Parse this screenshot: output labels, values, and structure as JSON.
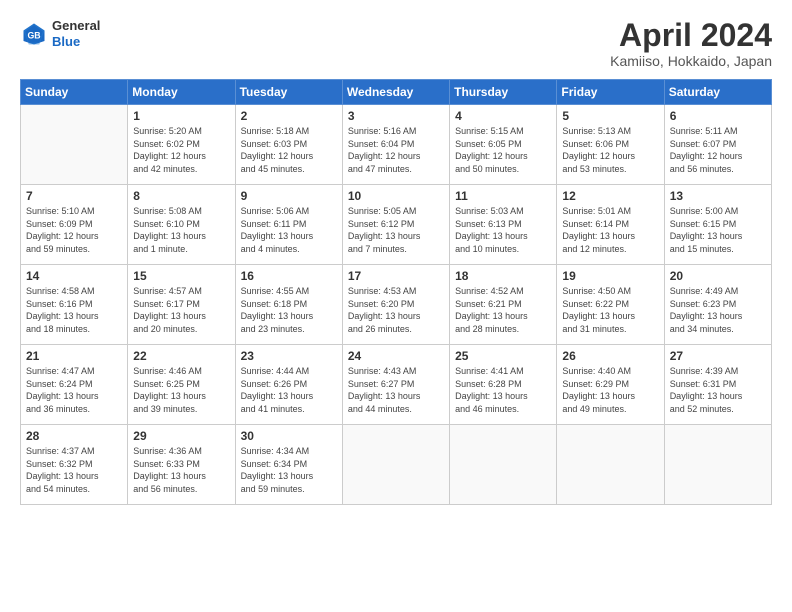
{
  "header": {
    "logo_general": "General",
    "logo_blue": "Blue",
    "month_title": "April 2024",
    "location": "Kamiiso, Hokkaido, Japan"
  },
  "days_of_week": [
    "Sunday",
    "Monday",
    "Tuesday",
    "Wednesday",
    "Thursday",
    "Friday",
    "Saturday"
  ],
  "weeks": [
    [
      {
        "day": "",
        "info": ""
      },
      {
        "day": "1",
        "info": "Sunrise: 5:20 AM\nSunset: 6:02 PM\nDaylight: 12 hours\nand 42 minutes."
      },
      {
        "day": "2",
        "info": "Sunrise: 5:18 AM\nSunset: 6:03 PM\nDaylight: 12 hours\nand 45 minutes."
      },
      {
        "day": "3",
        "info": "Sunrise: 5:16 AM\nSunset: 6:04 PM\nDaylight: 12 hours\nand 47 minutes."
      },
      {
        "day": "4",
        "info": "Sunrise: 5:15 AM\nSunset: 6:05 PM\nDaylight: 12 hours\nand 50 minutes."
      },
      {
        "day": "5",
        "info": "Sunrise: 5:13 AM\nSunset: 6:06 PM\nDaylight: 12 hours\nand 53 minutes."
      },
      {
        "day": "6",
        "info": "Sunrise: 5:11 AM\nSunset: 6:07 PM\nDaylight: 12 hours\nand 56 minutes."
      }
    ],
    [
      {
        "day": "7",
        "info": "Sunrise: 5:10 AM\nSunset: 6:09 PM\nDaylight: 12 hours\nand 59 minutes."
      },
      {
        "day": "8",
        "info": "Sunrise: 5:08 AM\nSunset: 6:10 PM\nDaylight: 13 hours\nand 1 minute."
      },
      {
        "day": "9",
        "info": "Sunrise: 5:06 AM\nSunset: 6:11 PM\nDaylight: 13 hours\nand 4 minutes."
      },
      {
        "day": "10",
        "info": "Sunrise: 5:05 AM\nSunset: 6:12 PM\nDaylight: 13 hours\nand 7 minutes."
      },
      {
        "day": "11",
        "info": "Sunrise: 5:03 AM\nSunset: 6:13 PM\nDaylight: 13 hours\nand 10 minutes."
      },
      {
        "day": "12",
        "info": "Sunrise: 5:01 AM\nSunset: 6:14 PM\nDaylight: 13 hours\nand 12 minutes."
      },
      {
        "day": "13",
        "info": "Sunrise: 5:00 AM\nSunset: 6:15 PM\nDaylight: 13 hours\nand 15 minutes."
      }
    ],
    [
      {
        "day": "14",
        "info": "Sunrise: 4:58 AM\nSunset: 6:16 PM\nDaylight: 13 hours\nand 18 minutes."
      },
      {
        "day": "15",
        "info": "Sunrise: 4:57 AM\nSunset: 6:17 PM\nDaylight: 13 hours\nand 20 minutes."
      },
      {
        "day": "16",
        "info": "Sunrise: 4:55 AM\nSunset: 6:18 PM\nDaylight: 13 hours\nand 23 minutes."
      },
      {
        "day": "17",
        "info": "Sunrise: 4:53 AM\nSunset: 6:20 PM\nDaylight: 13 hours\nand 26 minutes."
      },
      {
        "day": "18",
        "info": "Sunrise: 4:52 AM\nSunset: 6:21 PM\nDaylight: 13 hours\nand 28 minutes."
      },
      {
        "day": "19",
        "info": "Sunrise: 4:50 AM\nSunset: 6:22 PM\nDaylight: 13 hours\nand 31 minutes."
      },
      {
        "day": "20",
        "info": "Sunrise: 4:49 AM\nSunset: 6:23 PM\nDaylight: 13 hours\nand 34 minutes."
      }
    ],
    [
      {
        "day": "21",
        "info": "Sunrise: 4:47 AM\nSunset: 6:24 PM\nDaylight: 13 hours\nand 36 minutes."
      },
      {
        "day": "22",
        "info": "Sunrise: 4:46 AM\nSunset: 6:25 PM\nDaylight: 13 hours\nand 39 minutes."
      },
      {
        "day": "23",
        "info": "Sunrise: 4:44 AM\nSunset: 6:26 PM\nDaylight: 13 hours\nand 41 minutes."
      },
      {
        "day": "24",
        "info": "Sunrise: 4:43 AM\nSunset: 6:27 PM\nDaylight: 13 hours\nand 44 minutes."
      },
      {
        "day": "25",
        "info": "Sunrise: 4:41 AM\nSunset: 6:28 PM\nDaylight: 13 hours\nand 46 minutes."
      },
      {
        "day": "26",
        "info": "Sunrise: 4:40 AM\nSunset: 6:29 PM\nDaylight: 13 hours\nand 49 minutes."
      },
      {
        "day": "27",
        "info": "Sunrise: 4:39 AM\nSunset: 6:31 PM\nDaylight: 13 hours\nand 52 minutes."
      }
    ],
    [
      {
        "day": "28",
        "info": "Sunrise: 4:37 AM\nSunset: 6:32 PM\nDaylight: 13 hours\nand 54 minutes."
      },
      {
        "day": "29",
        "info": "Sunrise: 4:36 AM\nSunset: 6:33 PM\nDaylight: 13 hours\nand 56 minutes."
      },
      {
        "day": "30",
        "info": "Sunrise: 4:34 AM\nSunset: 6:34 PM\nDaylight: 13 hours\nand 59 minutes."
      },
      {
        "day": "",
        "info": ""
      },
      {
        "day": "",
        "info": ""
      },
      {
        "day": "",
        "info": ""
      },
      {
        "day": "",
        "info": ""
      }
    ]
  ]
}
